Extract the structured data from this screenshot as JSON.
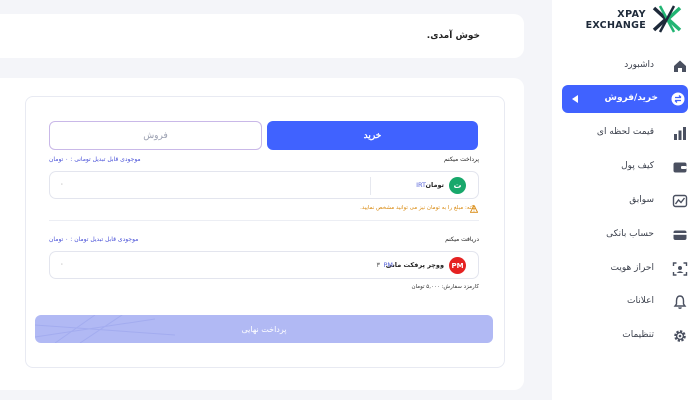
{
  "brand": {
    "line1": "XPAY",
    "line2": "EXCHANGE"
  },
  "header": {
    "welcome": "خوش آمدی."
  },
  "sidebar": {
    "items": [
      {
        "label": "داشبورد",
        "icon": "home-icon"
      },
      {
        "label": "خرید/فروش",
        "icon": "exchange-icon",
        "active": true
      },
      {
        "label": "قیمت لحظه ای",
        "icon": "bar-chart-icon"
      },
      {
        "label": "کیف پول",
        "icon": "wallet-icon"
      },
      {
        "label": "سوابق",
        "icon": "history-icon"
      },
      {
        "label": "حساب بانکی",
        "icon": "card-icon"
      },
      {
        "label": "احراز هویت",
        "icon": "id-icon"
      },
      {
        "label": "اعلانات",
        "icon": "bell-icon"
      },
      {
        "label": "تنظیمات",
        "icon": "gear-icon"
      }
    ]
  },
  "tabs": {
    "buy": "خرید",
    "sell": "فروش"
  },
  "pay": {
    "label": "پرداخت میکنم",
    "balance": "موجودی قابل تبدیل تومانی : ۰ تومان",
    "currency_name": "تومان",
    "currency_code": "IRT",
    "currency_glyph": "ت",
    "amount": "۰",
    "warning": "نکته: مبلغ را به تومان نیز می توانید مشخص نمایید."
  },
  "receive": {
    "label": "دریافت میکنم",
    "balance": "موجودی قابل تبدیل تومان : ۰ تومان",
    "currency_name": "ووچر پرفکت مانی",
    "currency_code": "PM",
    "currency_glyph": "PM",
    "count": "۳",
    "amount": "۰",
    "fee": "کارمزد سفارش: ۵,۰۰۰ تومان"
  },
  "final_button": "پرداخت نهایی",
  "colors": {
    "accent": "#4062ff",
    "disabled": "#b1b9f4",
    "warning": "#d98a10",
    "toman": "#18a86b",
    "pm": "#e52222"
  }
}
